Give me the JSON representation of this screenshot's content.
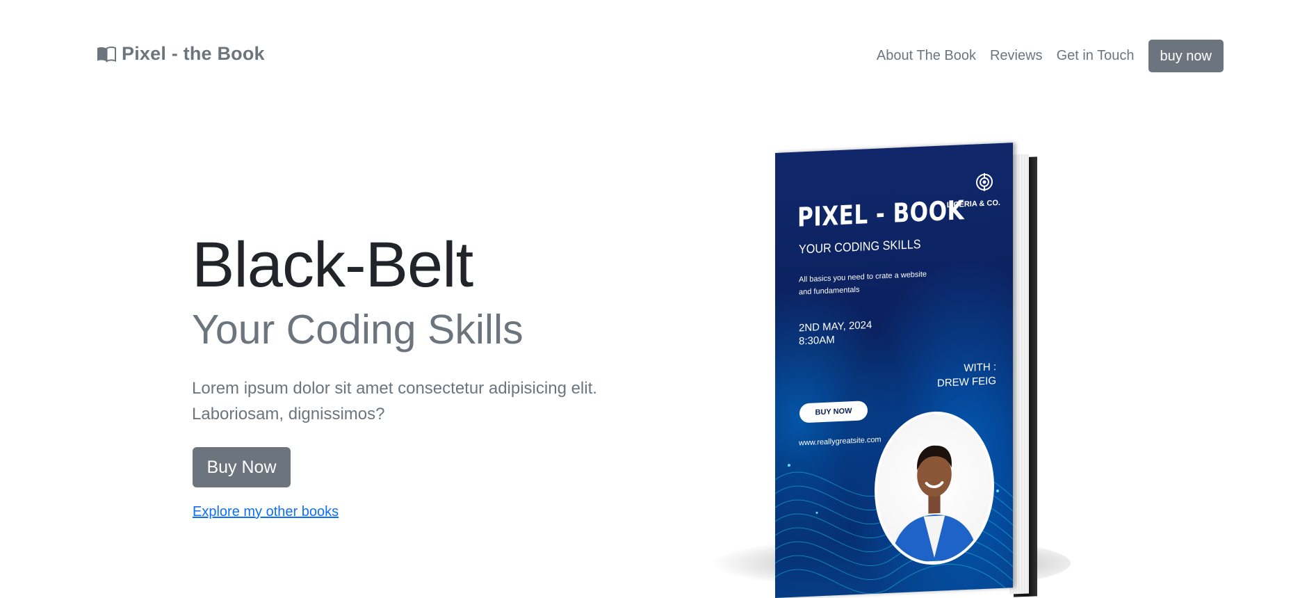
{
  "navbar": {
    "brand": "Pixel - the Book",
    "links": [
      "About The Book",
      "Reviews",
      "Get in Touch"
    ],
    "cta": "buy now"
  },
  "hero": {
    "title": "Black-Belt",
    "subtitle": "Your Coding Skills",
    "lead": "Lorem ipsum dolor sit amet consectetur adipisicing elit. Laboriosam, dignissimos?",
    "buy_button": "Buy Now",
    "explore_link": "Explore my other books"
  },
  "book_cover": {
    "title": "PIXEL - BOOK",
    "subtitle": "YOUR CODING SKILLS",
    "description": "All  basics you need to crate a website and fundamentals",
    "date": "2ND MAY, 2024\n8:30AM",
    "with": "WITH :\nDREW FEIG",
    "button": "BUY NOW",
    "url": "www.reallygreatsite.com",
    "publisher": "LICERIA & CO."
  },
  "colors": {
    "secondary": "#6c757d",
    "link": "#0d6efd",
    "cover_navy": "#0a1f5c"
  }
}
